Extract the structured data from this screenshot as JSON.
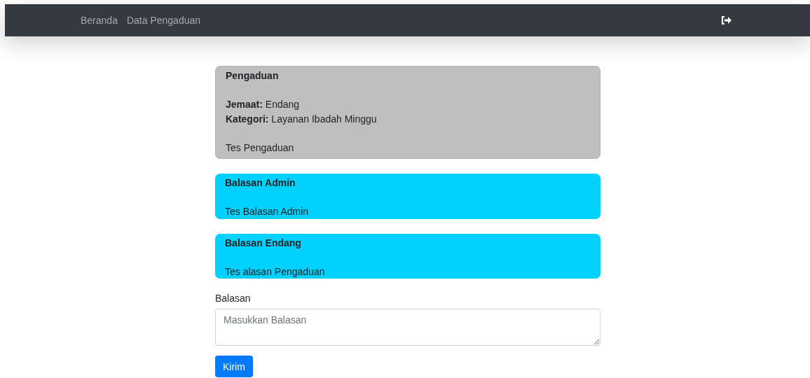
{
  "navbar": {
    "links": [
      {
        "label": "Beranda"
      },
      {
        "label": "Data Pengaduan"
      }
    ]
  },
  "complaint": {
    "title": "Pengaduan",
    "fields": [
      "**Jemaat:** Endang",
      "**Kategori:** Layanan Ibadah Minggu"
    ],
    "body": "Tes Pengaduan"
  },
  "replies": [
    {
      "title": "Balasan Admin",
      "body": "Tes Balasan Admin"
    },
    {
      "title": "Balasan Endang",
      "body": "Tes alasan Pengaduan"
    }
  ],
  "form": {
    "label": "Balasan",
    "placeholder": "Masukkan Balasan",
    "button": "Kirim"
  }
}
